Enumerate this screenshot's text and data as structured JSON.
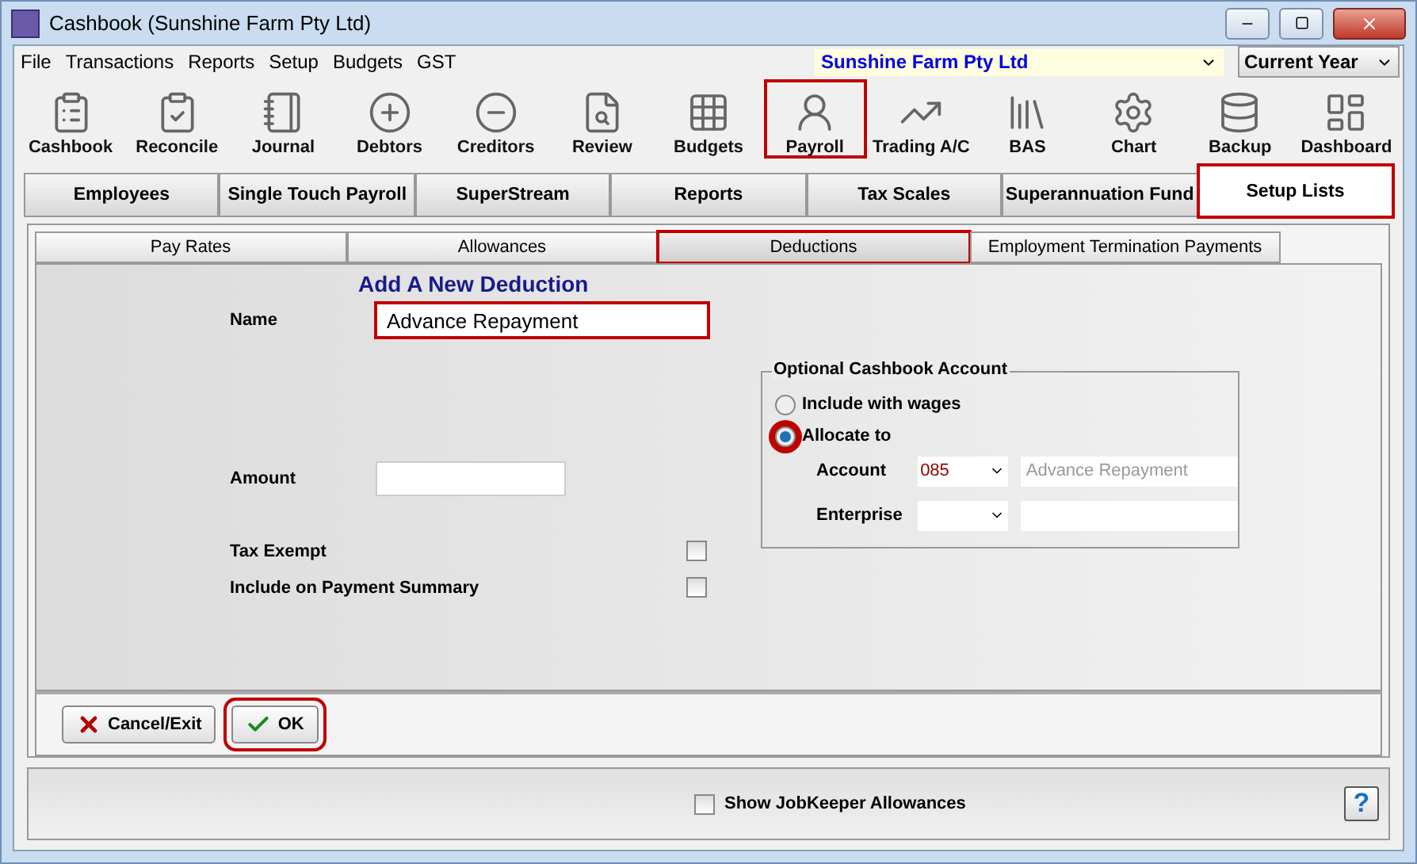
{
  "window": {
    "title": "Cashbook (Sunshine Farm Pty Ltd)"
  },
  "menu": [
    "File",
    "Transactions",
    "Reports",
    "Setup",
    "Budgets",
    "GST"
  ],
  "company": "Sunshine Farm Pty Ltd",
  "period": "Current Year",
  "toolbar": [
    {
      "label": "Cashbook",
      "highlighted": false
    },
    {
      "label": "Reconcile",
      "highlighted": false
    },
    {
      "label": "Journal",
      "highlighted": false
    },
    {
      "label": "Debtors",
      "highlighted": false
    },
    {
      "label": "Creditors",
      "highlighted": false
    },
    {
      "label": "Review",
      "highlighted": false
    },
    {
      "label": "Budgets",
      "highlighted": false
    },
    {
      "label": "Payroll",
      "highlighted": true
    },
    {
      "label": "Trading A/C",
      "highlighted": false
    },
    {
      "label": "BAS",
      "highlighted": false
    },
    {
      "label": "Chart",
      "highlighted": false
    },
    {
      "label": "Backup",
      "highlighted": false
    },
    {
      "label": "Dashboard",
      "highlighted": false
    }
  ],
  "tabs": [
    {
      "label": "Employees",
      "selected": false,
      "highlighted": false
    },
    {
      "label": "Single Touch Payroll",
      "selected": false,
      "highlighted": false
    },
    {
      "label": "SuperStream",
      "selected": false,
      "highlighted": false
    },
    {
      "label": "Reports",
      "selected": false,
      "highlighted": false
    },
    {
      "label": "Tax Scales",
      "selected": false,
      "highlighted": false
    },
    {
      "label": "Superannuation Fund",
      "selected": false,
      "highlighted": false
    },
    {
      "label": "Setup Lists",
      "selected": true,
      "highlighted": true
    }
  ],
  "subtabs": [
    {
      "label": "Pay Rates",
      "selected": false,
      "highlighted": false
    },
    {
      "label": "Allowances",
      "selected": false,
      "highlighted": false
    },
    {
      "label": "Deductions",
      "selected": true,
      "highlighted": true
    },
    {
      "label": "Employment Termination Payments",
      "selected": false,
      "highlighted": false
    }
  ],
  "form": {
    "heading": "Add A New Deduction",
    "name_label": "Name",
    "name_value": "Advance Repayment",
    "name_highlighted": true,
    "amount_label": "Amount",
    "checkboxes": [
      {
        "label": "Tax Exempt",
        "checked": false
      },
      {
        "label": "Include on Payment Summary",
        "checked": false
      }
    ]
  },
  "account_group": {
    "title": "Optional Cashbook Account",
    "options": [
      {
        "label": "Include with wages",
        "selected": false,
        "highlighted": false
      },
      {
        "label": "Allocate to",
        "selected": true,
        "highlighted": true
      }
    ],
    "account_label": "Account",
    "account_code": "085",
    "account_name": "Advance Repayment",
    "enterprise_label": "Enterprise"
  },
  "buttons": [
    {
      "label": "Cancel/Exit",
      "kind": "cancel",
      "highlighted": false
    },
    {
      "label": "OK",
      "kind": "ok",
      "highlighted": true
    }
  ],
  "footer": {
    "checkbox": {
      "label": "Show JobKeeper Allowances",
      "checked": false
    },
    "help": "?"
  }
}
